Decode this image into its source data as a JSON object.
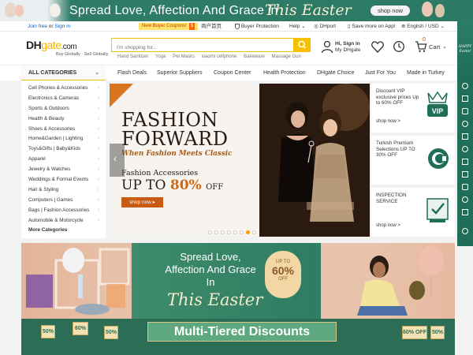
{
  "top_banner": {
    "headline": "Spread Love, Affection And Grace in",
    "script": "This Easter",
    "button": "shop now"
  },
  "utility_bar": {
    "join_free": "Join free",
    "or": "or",
    "sign_in": "Sign in",
    "coupon_text": "New Buyer Coupons!",
    "coupon_amount": "$",
    "chinese_link": "商户首页",
    "buyer_protection": "Buyer Protection",
    "help": "Help",
    "dhport": "DHport",
    "app_promo": "Save more on App!",
    "locale": "English / USD"
  },
  "header": {
    "logo_dh": "DH",
    "logo_gate": "gate",
    "logo_dotcom": ".com",
    "logo_tagline": "Buy Globally · Sell Globally",
    "search_placeholder": "I'm shopping for...",
    "hot_words": [
      "Hand Sanitizer",
      "Yoga",
      "Pet Masks",
      "xiaomi cellphone",
      "Bakeware",
      "Massage Gun"
    ],
    "greeting": "Hi, Sign in",
    "my_dhgate": "My DHgate",
    "cart_label": "Cart",
    "cart_count": "0"
  },
  "navbar": {
    "all_categories": "ALL CATEGORIES",
    "items": [
      "Flash Deals",
      "Superior Suppliers",
      "Coupon Center",
      "Health Protection",
      "DHgate Choice",
      "Just For You",
      "Made in Turkey"
    ]
  },
  "categories": [
    "Cell Phones & Accessories",
    "Electronics & Cameras",
    "Sports & Outdoors",
    "Health & Beauty",
    "Shoes & Accessories",
    "Home&Garden | Lighting",
    "Toys&Gifts | Baby&Kids",
    "Apparel",
    "Jewelry & Watches",
    "Weddings & Formal Events",
    "Hair & Styling",
    "Computers | Games",
    "Bags | Fashion Accessories",
    "Automobile & Motorcycle",
    "More Categories"
  ],
  "hero": {
    "headline_1": "FASHION",
    "headline_2": "FORWARD",
    "subline": "When Fashion Meets Classic",
    "category": "Fashion Accessories",
    "upto": "UP TO",
    "percent": "80%",
    "off": "OFF",
    "cta": "shop now ▸",
    "slide_count": 8,
    "active_slide": 7
  },
  "promos": [
    {
      "title": "Discount VIP exclusive prices Up to 60% OFF",
      "cta": "shop now >",
      "icon_text": "VIP"
    },
    {
      "title": "Turkish Premium Selections UP TO 30% OFF",
      "cta": "shop now >"
    },
    {
      "title": "INSPECTION SERVICE",
      "cta": "shop now >"
    }
  ],
  "rail": {
    "label": "HAPPY Easter"
  },
  "easter_banner": {
    "line1": "Spread Love,",
    "line2": "Affection And Grace",
    "line3": "In",
    "script": "This Easter",
    "badge_upto": "UP TO",
    "badge_pct": "60%",
    "badge_off": "OFF",
    "discount_title": "Multi-Tiered Discounts",
    "chips": [
      "50%",
      "60%",
      "50%",
      "60% OFF",
      "50%"
    ]
  },
  "colors": {
    "brand_yellow": "#f5c000",
    "easter_green": "#2c7a66",
    "accent_orange": "#d06a16"
  }
}
